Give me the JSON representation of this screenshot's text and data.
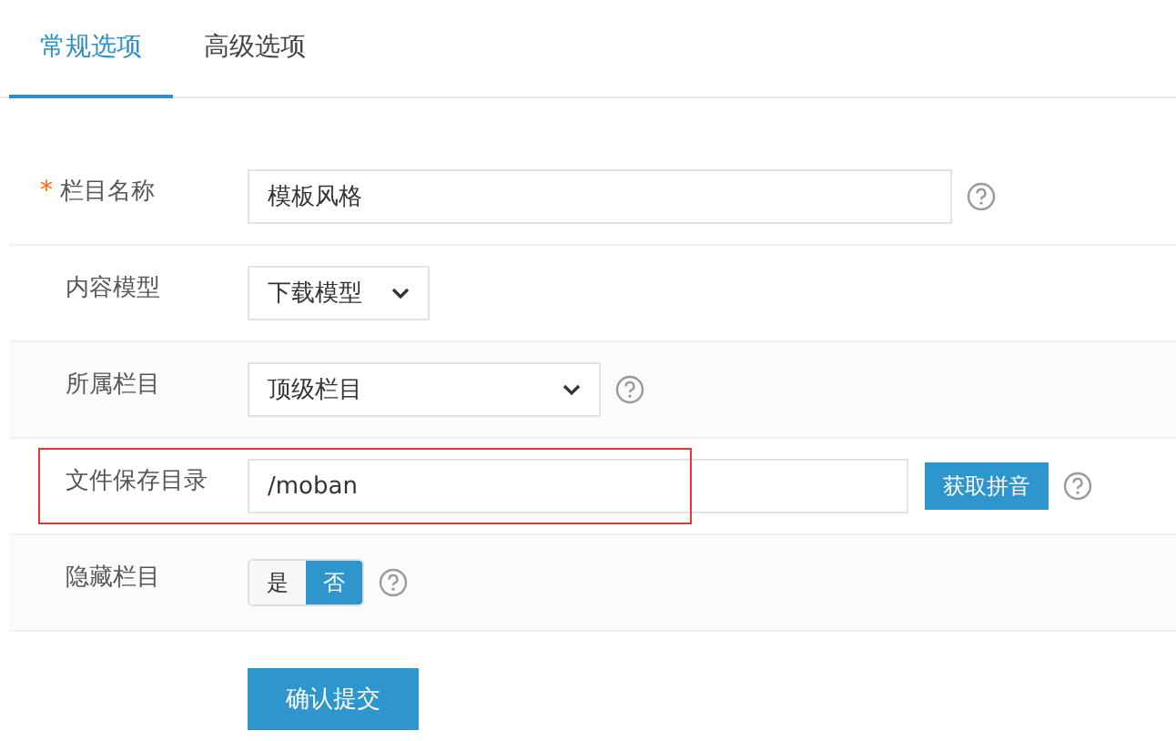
{
  "tabs": [
    {
      "label": "常规选项",
      "selected": true
    },
    {
      "label": "高级选项",
      "selected": false
    }
  ],
  "form": {
    "rows": [
      {
        "kind": "text",
        "label": "栏目名称",
        "required": true,
        "required_marker": "*",
        "value": "模板风格",
        "help": true,
        "highlighted": false
      },
      {
        "kind": "select",
        "label": "内容模型",
        "required": false,
        "value": "下载模型",
        "help": false,
        "highlighted": false
      },
      {
        "kind": "select",
        "label": "所属栏目",
        "required": false,
        "value": "顶级栏目",
        "help": true,
        "highlighted": false
      },
      {
        "kind": "text",
        "label": "文件保存目录",
        "required": false,
        "value": "/moban",
        "button": "获取拼音",
        "help": true,
        "highlighted": true
      },
      {
        "kind": "toggle",
        "label": "隐藏栏目",
        "required": false,
        "options": [
          {
            "label": "是",
            "selected": false
          },
          {
            "label": "否",
            "selected": true
          }
        ],
        "help": true,
        "highlighted": false
      }
    ]
  },
  "submit": "确认提交"
}
